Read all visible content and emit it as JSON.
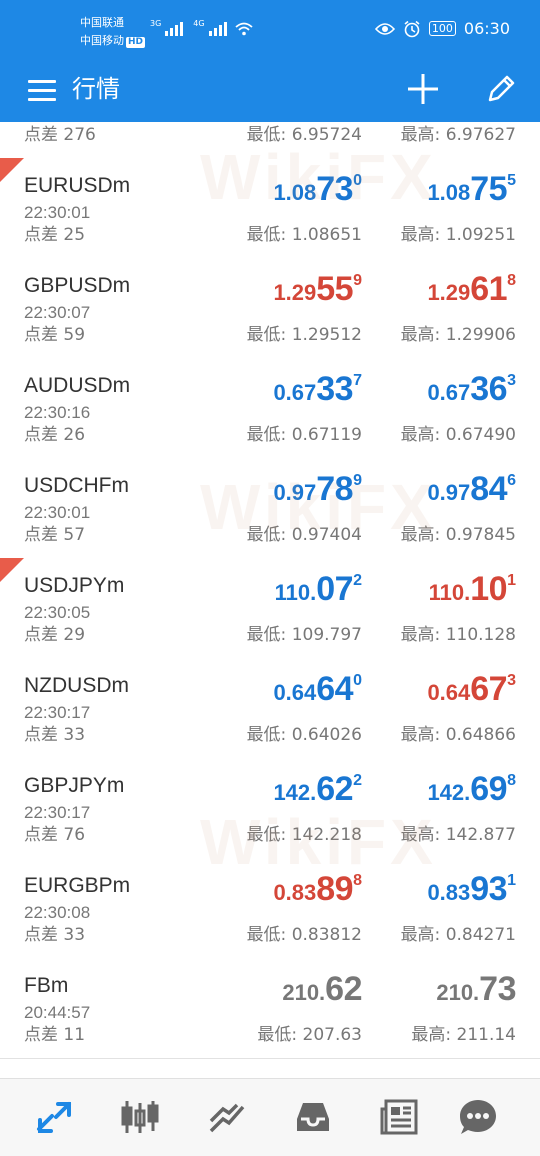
{
  "status": {
    "carrier1": "中国联通",
    "carrier2": "中国移动",
    "hd": "HD",
    "net1": "3G",
    "net2": "4G",
    "battery": "100",
    "time": "06:30"
  },
  "toolbar": {
    "title": "行情"
  },
  "partial_row": {
    "spread": "点差 276",
    "low": "最低: 6.95724",
    "high": "最高: 6.97627"
  },
  "quotes": [
    {
      "symbol": "EURUSDm",
      "time": "22:30:01",
      "spread": "点差 25",
      "bid": {
        "pre": "1.08",
        "big": "73",
        "pip": "0",
        "color": "blue"
      },
      "ask": {
        "pre": "1.08",
        "big": "75",
        "pip": "5",
        "color": "blue"
      },
      "low": "最低: 1.08651",
      "high": "最高: 1.09251",
      "flag": true
    },
    {
      "symbol": "GBPUSDm",
      "time": "22:30:07",
      "spread": "点差 59",
      "bid": {
        "pre": "1.29",
        "big": "55",
        "pip": "9",
        "color": "red"
      },
      "ask": {
        "pre": "1.29",
        "big": "61",
        "pip": "8",
        "color": "red"
      },
      "low": "最低: 1.29512",
      "high": "最高: 1.29906",
      "flag": false
    },
    {
      "symbol": "AUDUSDm",
      "time": "22:30:16",
      "spread": "点差 26",
      "bid": {
        "pre": "0.67",
        "big": "33",
        "pip": "7",
        "color": "blue"
      },
      "ask": {
        "pre": "0.67",
        "big": "36",
        "pip": "3",
        "color": "blue"
      },
      "low": "最低: 0.67119",
      "high": "最高: 0.67490",
      "flag": false
    },
    {
      "symbol": "USDCHFm",
      "time": "22:30:01",
      "spread": "点差 57",
      "bid": {
        "pre": "0.97",
        "big": "78",
        "pip": "9",
        "color": "blue"
      },
      "ask": {
        "pre": "0.97",
        "big": "84",
        "pip": "6",
        "color": "blue"
      },
      "low": "最低: 0.97404",
      "high": "最高: 0.97845",
      "flag": false
    },
    {
      "symbol": "USDJPYm",
      "time": "22:30:05",
      "spread": "点差 29",
      "bid": {
        "pre": "110.",
        "big": "07",
        "pip": "2",
        "color": "blue"
      },
      "ask": {
        "pre": "110.",
        "big": "10",
        "pip": "1",
        "color": "red"
      },
      "low": "最低: 109.797",
      "high": "最高: 110.128",
      "flag": true
    },
    {
      "symbol": "NZDUSDm",
      "time": "22:30:17",
      "spread": "点差 33",
      "bid": {
        "pre": "0.64",
        "big": "64",
        "pip": "0",
        "color": "blue"
      },
      "ask": {
        "pre": "0.64",
        "big": "67",
        "pip": "3",
        "color": "red"
      },
      "low": "最低: 0.64026",
      "high": "最高: 0.64866",
      "flag": false
    },
    {
      "symbol": "GBPJPYm",
      "time": "22:30:17",
      "spread": "点差 76",
      "bid": {
        "pre": "142.",
        "big": "62",
        "pip": "2",
        "color": "blue"
      },
      "ask": {
        "pre": "142.",
        "big": "69",
        "pip": "8",
        "color": "blue"
      },
      "low": "最低: 142.218",
      "high": "最高: 142.877",
      "flag": false
    },
    {
      "symbol": "EURGBPm",
      "time": "22:30:08",
      "spread": "点差 33",
      "bid": {
        "pre": "0.83",
        "big": "89",
        "pip": "8",
        "color": "red"
      },
      "ask": {
        "pre": "0.83",
        "big": "93",
        "pip": "1",
        "color": "blue"
      },
      "low": "最低: 0.83812",
      "high": "最高: 0.84271",
      "flag": false
    },
    {
      "symbol": "FBm",
      "time": "20:44:57",
      "spread": "点差 11",
      "bid": {
        "pre": "210.",
        "big": "62",
        "pip": "",
        "color": "gray"
      },
      "ask": {
        "pre": "210.",
        "big": "73",
        "pip": "",
        "color": "gray"
      },
      "low": "最低: 207.63",
      "high": "最高: 211.14",
      "flag": false
    }
  ],
  "watermark": "WikiFX",
  "colors": {
    "accent": "#1e88e5",
    "up": "#1976d2",
    "down": "#d44638"
  },
  "bottom_nav": [
    "quotes-icon",
    "chart-icon",
    "trade-icon",
    "history-icon",
    "news-icon",
    "chat-icon"
  ]
}
